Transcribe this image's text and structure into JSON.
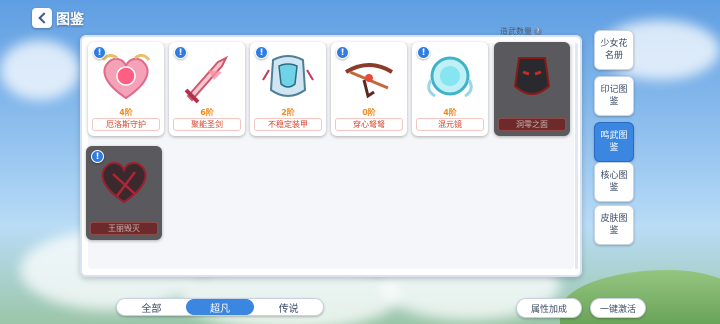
{
  "header": {
    "title": "图鉴",
    "back_label": ""
  },
  "collection": {
    "label": "造武数量",
    "value": ""
  },
  "items": [
    {
      "tier": "4阶",
      "name": "厄洛斯守护",
      "locked": false,
      "has_alert": true
    },
    {
      "tier": "6阶",
      "name": "聚能圣剑",
      "locked": false,
      "has_alert": true
    },
    {
      "tier": "2阶",
      "name": "不稳定装甲",
      "locked": false,
      "has_alert": true
    },
    {
      "tier": "0阶",
      "name": "穿心弩弩",
      "locked": false,
      "has_alert": true
    },
    {
      "tier": "4阶",
      "name": "混元镜",
      "locked": false,
      "has_alert": true
    },
    {
      "tier": "",
      "name": "洞零之面",
      "locked": true,
      "has_alert": false
    },
    {
      "tier": "",
      "name": "王丽毁灭",
      "locked": true,
      "has_alert": true
    }
  ],
  "side_tabs": [
    {
      "label": "少女花名册",
      "active": false
    },
    {
      "label": "印记图鉴",
      "active": false
    },
    {
      "label": "鸣武图鉴",
      "active": true
    },
    {
      "label": "核心图鉴",
      "active": false
    },
    {
      "label": "皮肤图鉴",
      "active": false
    }
  ],
  "filters": [
    {
      "label": "全部",
      "active": false
    },
    {
      "label": "超凡",
      "active": true
    },
    {
      "label": "传说",
      "active": false
    }
  ],
  "buttons": {
    "attribute_bonus": "属性加成",
    "activate_all": "一键激活"
  },
  "colors": {
    "accent": "#3a86e0",
    "tier_text": "#f08a1c",
    "name_text": "#d6402e"
  }
}
